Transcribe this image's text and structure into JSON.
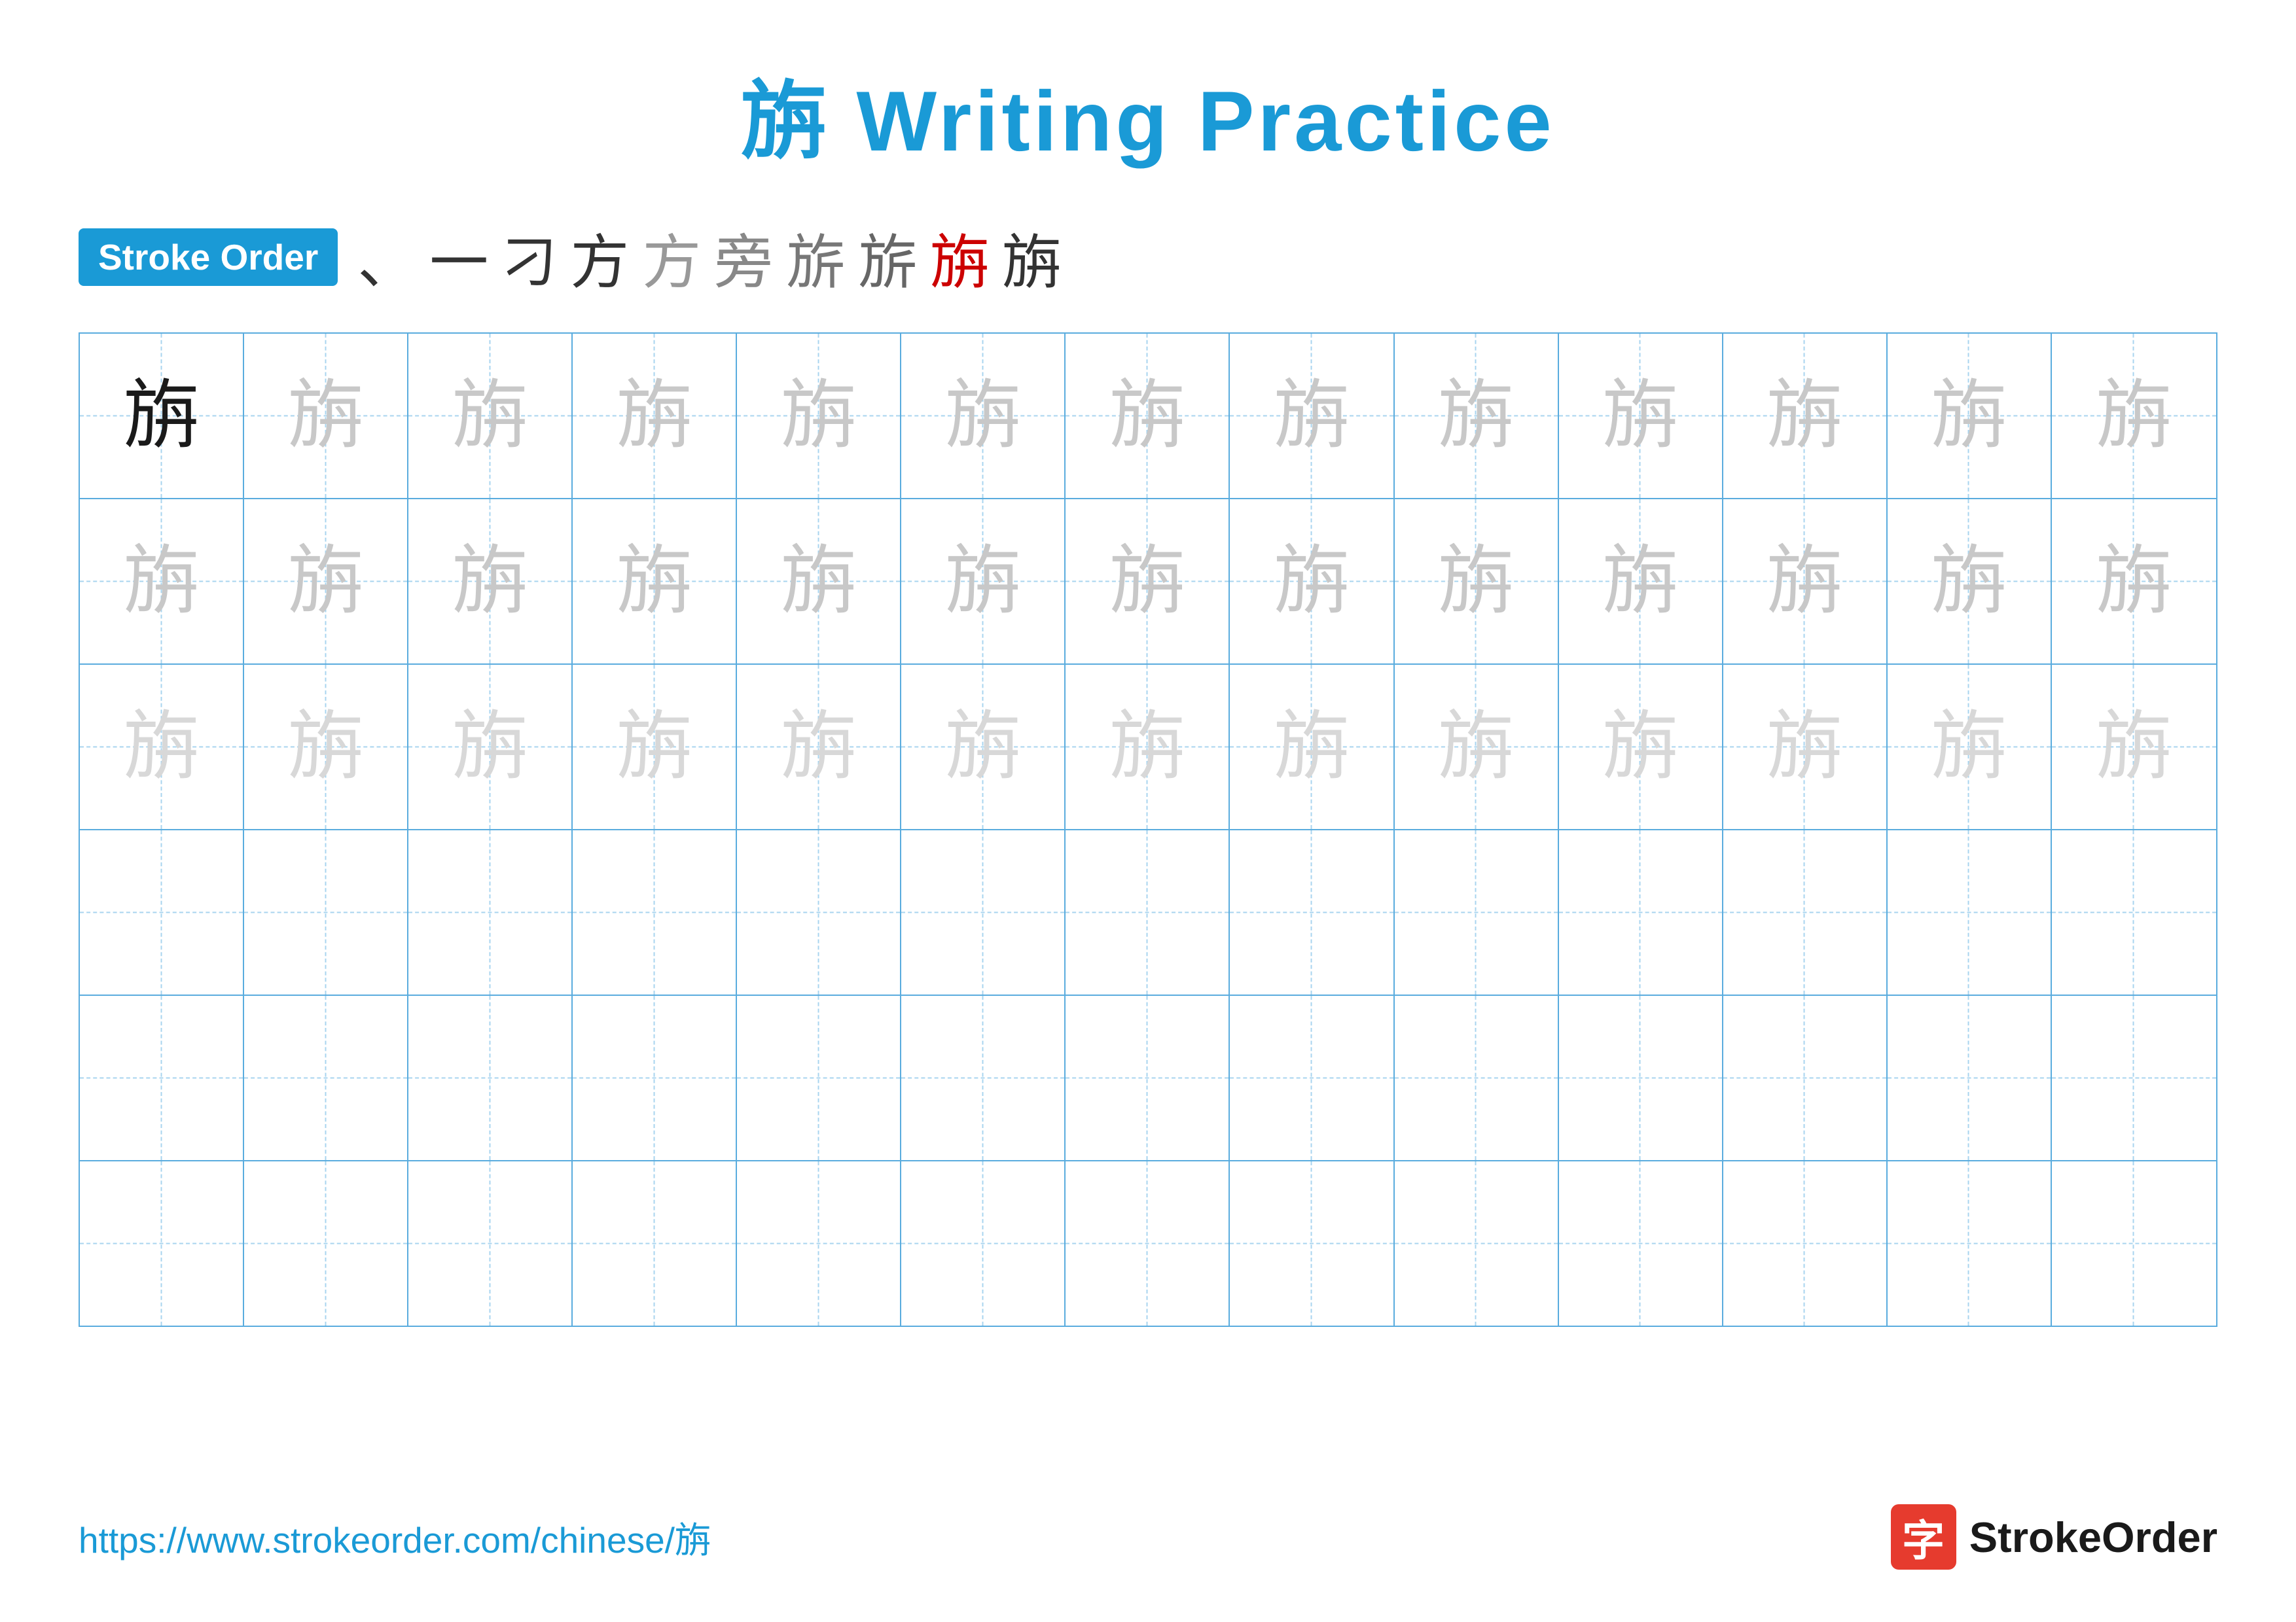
{
  "page": {
    "title": "旃 Writing Practice",
    "character": "旃",
    "stroke_order_label": "Stroke Order",
    "stroke_sequence": [
      "、",
      "一",
      "刁",
      "方",
      "方",
      "𠂉",
      "𠂉",
      "旂",
      "旃",
      "旃"
    ],
    "url": "https://www.strokeorder.com/chinese/旃",
    "logo_char": "字",
    "logo_text": "StrokeOrder",
    "grid": {
      "rows": 6,
      "cols": 13,
      "row_data": [
        [
          "dark",
          "light1",
          "light1",
          "light1",
          "light1",
          "light1",
          "light1",
          "light1",
          "light1",
          "light1",
          "light1",
          "light1",
          "light1"
        ],
        [
          "light1",
          "light1",
          "light1",
          "light1",
          "light1",
          "light1",
          "light1",
          "light1",
          "light1",
          "light1",
          "light1",
          "light1",
          "light1"
        ],
        [
          "light2",
          "light2",
          "light2",
          "light2",
          "light2",
          "light2",
          "light2",
          "light2",
          "light2",
          "light2",
          "light2",
          "light2",
          "light2"
        ],
        [
          "empty",
          "empty",
          "empty",
          "empty",
          "empty",
          "empty",
          "empty",
          "empty",
          "empty",
          "empty",
          "empty",
          "empty",
          "empty"
        ],
        [
          "empty",
          "empty",
          "empty",
          "empty",
          "empty",
          "empty",
          "empty",
          "empty",
          "empty",
          "empty",
          "empty",
          "empty",
          "empty"
        ],
        [
          "empty",
          "empty",
          "empty",
          "empty",
          "empty",
          "empty",
          "empty",
          "empty",
          "empty",
          "empty",
          "empty",
          "empty",
          "empty"
        ]
      ]
    },
    "colors": {
      "blue": "#1a9ad6",
      "red": "#cc0000",
      "badge_bg": "#1a9ad6",
      "grid_border": "#5aacde",
      "grid_dashed": "#a8d4ef",
      "logo_bg": "#e63b2e"
    }
  }
}
